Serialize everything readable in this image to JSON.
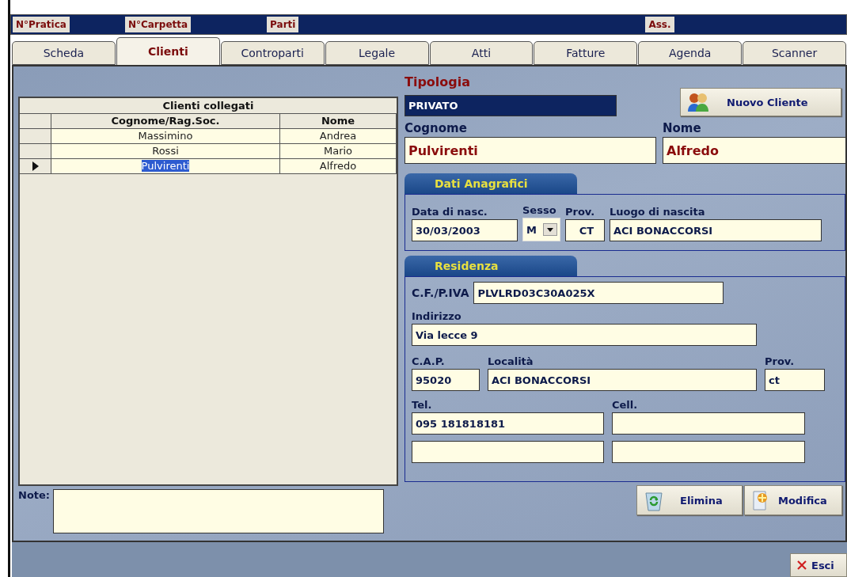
{
  "header_fields": [
    {
      "label": "N°Pratica"
    },
    {
      "label": "N°Carpetta"
    },
    {
      "label": "Parti"
    },
    {
      "label": "Ass."
    }
  ],
  "tabs": [
    {
      "label": "Scheda",
      "selected": false
    },
    {
      "label": "Clienti",
      "selected": true
    },
    {
      "label": "Controparti",
      "selected": false
    },
    {
      "label": "Legale",
      "selected": false
    },
    {
      "label": "Atti",
      "selected": false
    },
    {
      "label": "Fatture",
      "selected": false
    },
    {
      "label": "Agenda",
      "selected": false
    },
    {
      "label": "Scanner",
      "selected": false
    }
  ],
  "clients_table": {
    "title": "Clienti collegati",
    "columns": [
      "Cognome/Rag.Soc.",
      "Nome"
    ],
    "rows": [
      {
        "cells": [
          "Massimino",
          "Andrea"
        ],
        "selected": false
      },
      {
        "cells": [
          "Rossi",
          "Mario"
        ],
        "selected": false
      },
      {
        "cells": [
          "Pulvirenti",
          "Alfredo"
        ],
        "selected": true
      }
    ]
  },
  "note": {
    "label": "Note:"
  },
  "tipologia": {
    "label": "Tipologia",
    "value": "PRIVATO"
  },
  "new_client_button": {
    "label": "Nuovo Cliente"
  },
  "cognome": {
    "label": "Cognome",
    "value": "Pulvirenti"
  },
  "nome": {
    "label": "Nome",
    "value": "Alfredo"
  },
  "dati_anagrafici": {
    "title": "Dati Anagrafici",
    "birth_date": {
      "label": "Data di nasc.",
      "value": "30/03/2003"
    },
    "sex": {
      "label": "Sesso",
      "value": "M"
    },
    "province": {
      "label": "Prov.",
      "value": "CT"
    },
    "birthplace": {
      "label": "Luogo di nascita",
      "value": "ACI BONACCORSI"
    }
  },
  "residenza": {
    "title": "Residenza",
    "tax_code": {
      "label": "C.F./P.IVA",
      "value": "PLVLRD03C30A025X"
    },
    "address": {
      "label": "Indirizzo",
      "value": "Via lecce 9"
    },
    "zip": {
      "label": "C.A.P.",
      "value": "95020"
    },
    "city": {
      "label": "Località",
      "value": "ACI BONACCORSI"
    },
    "province": {
      "label": "Prov.",
      "value": "ct"
    },
    "phone": {
      "label": "Tel.",
      "value": "095 181818181"
    },
    "mobile": {
      "label": "Cell."
    }
  },
  "buttons": {
    "delete": "Elimina",
    "edit": "Modifica",
    "exit": "Esci"
  }
}
